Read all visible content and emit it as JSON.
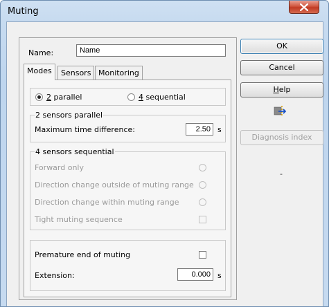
{
  "window": {
    "title": "Muting"
  },
  "name_field": {
    "label": "Name:",
    "value": "Name"
  },
  "tabs": [
    {
      "label": "Modes",
      "active": true
    },
    {
      "label": "Sensors",
      "active": false
    },
    {
      "label": "Monitoring",
      "active": false
    }
  ],
  "mode": {
    "parallel_label": "2 parallel",
    "sequential_label": "4 sequential",
    "selected": "2 parallel"
  },
  "parallel_group": {
    "caption": "2 sensors parallel",
    "max_time_label": "Maximum time difference:",
    "max_time_value": "2.50",
    "unit": "s"
  },
  "sequential_group": {
    "caption": "4 sensors sequential",
    "forward_only": "Forward only",
    "direction_outside": "Direction change outside of muting range",
    "direction_within": "Direction change within muting range",
    "tight_sequence": "Tight muting sequence"
  },
  "premature_group": {
    "premature_label": "Premature end of muting",
    "extension_label": "Extension:",
    "extension_value": "0.000",
    "unit": "s"
  },
  "buttons": {
    "ok": "OK",
    "cancel": "Cancel",
    "help": "Help",
    "diagnosis": "Diagnosis index"
  },
  "diagnosis_value": "-",
  "colors": {
    "accent": "#3c7fb1",
    "close": "#c13a24"
  }
}
